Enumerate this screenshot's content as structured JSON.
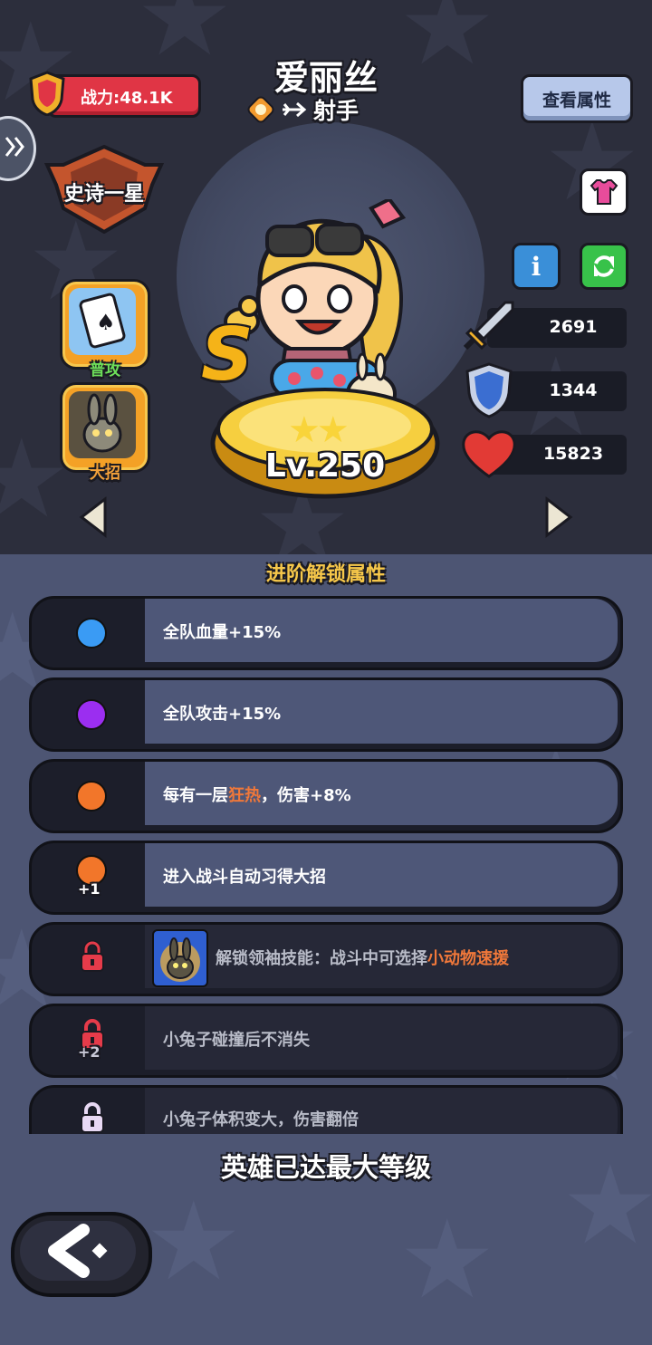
{
  "header": {
    "power_label": "战力:48.1K",
    "hero_name": "爱丽丝",
    "hero_class": "射手",
    "view_attributes_label": "查看属性"
  },
  "hero": {
    "rank_badge": "史诗一星",
    "grade": "S",
    "level_label": "Lv.250",
    "stars_filled": 2,
    "stars_total": 3,
    "skills": [
      {
        "label": "普攻",
        "icon": "card-icon"
      },
      {
        "label": "大招",
        "icon": "rabbit-icon"
      }
    ],
    "stats": [
      {
        "name": "attack",
        "icon": "sword-icon",
        "value": "2691"
      },
      {
        "name": "defense",
        "icon": "shield-icon",
        "value": "1344"
      },
      {
        "name": "hp",
        "icon": "heart-icon",
        "value": "15823"
      }
    ]
  },
  "unlock": {
    "title": "进阶解锁属性",
    "items": [
      {
        "dot_color": "#3a9bf4",
        "text": "全队血量+15%",
        "state": "unlocked"
      },
      {
        "dot_color": "#9b2ef0",
        "text": "全队攻击+15%",
        "state": "unlocked"
      },
      {
        "dot_color": "#f2762a",
        "text_before": "每有一层",
        "highlight": "狂热",
        "text_after": "，伤害+8%",
        "state": "unlocked"
      },
      {
        "dot_color": "#f2762a",
        "badge": "+1",
        "text": "进入战斗自动习得大招",
        "state": "unlocked"
      },
      {
        "lock_color": "#e63b4a",
        "text_before": "解锁领袖技能：战斗中可选择",
        "highlight": "小动物速援",
        "state": "locked"
      },
      {
        "lock_color": "#e63b4a",
        "badge": "+2",
        "text": "小兔子碰撞后不消失",
        "state": "locked"
      },
      {
        "lock_color": "#e8d9f4",
        "text": "小兔子体积变大，伤害翻倍",
        "state": "locked"
      }
    ]
  },
  "footer": {
    "max_level_text": "英雄已达最大等级"
  },
  "colors": {
    "power_red": "#e03545",
    "gold": "#f6c74a",
    "highlight_orange": "#f0783a"
  }
}
